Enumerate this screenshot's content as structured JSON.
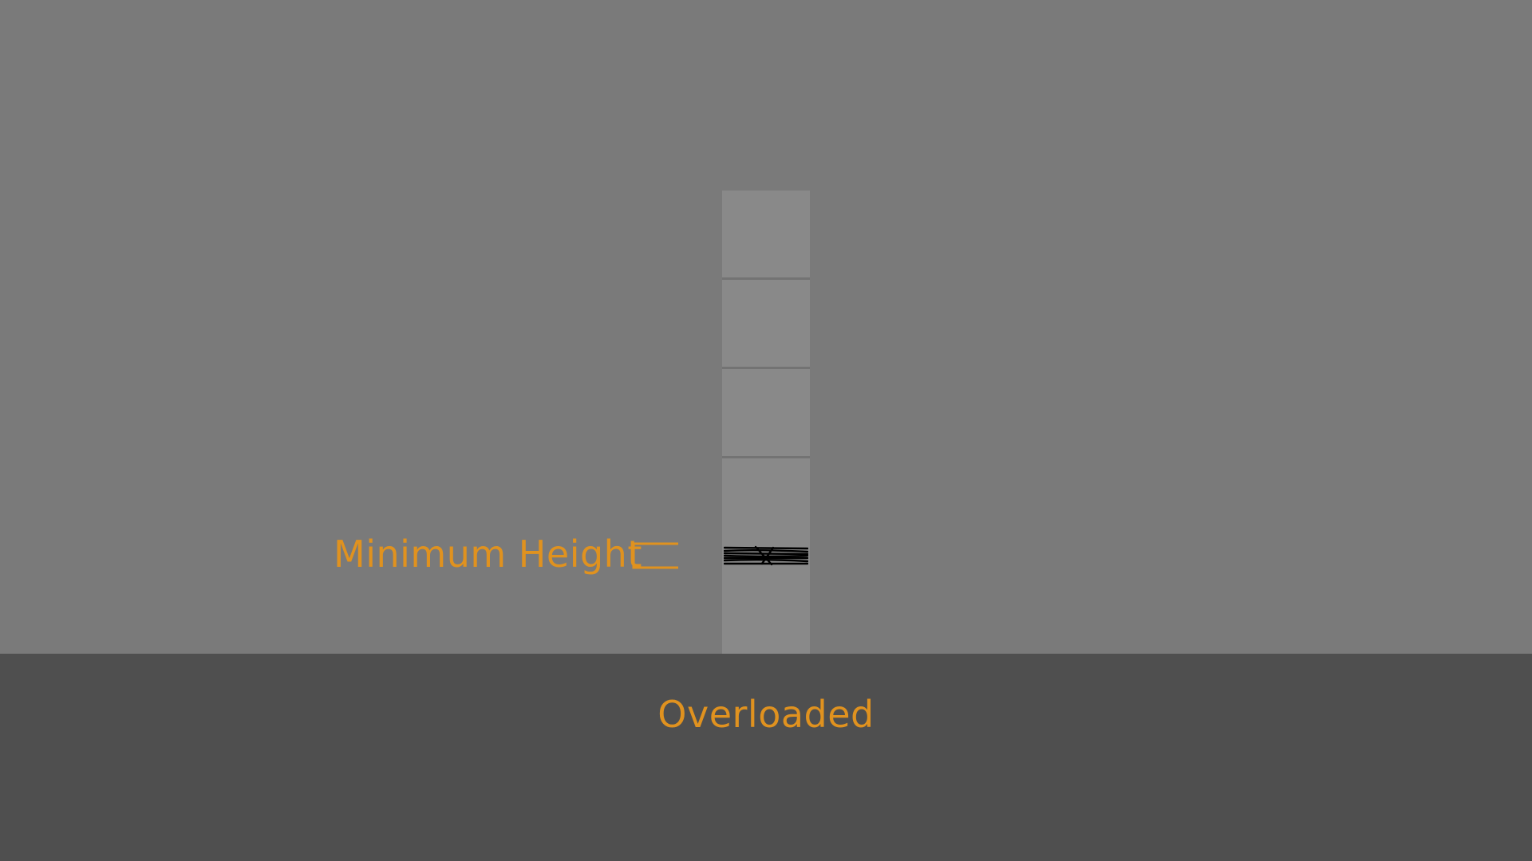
{
  "scene": {
    "background_color": "#7a7a7a",
    "column_color": "#898989",
    "divider_color": "#737373",
    "floor_color": "#4f4f4f",
    "accent_color": "#e0921f",
    "squash_color": "#000000"
  },
  "annotation": {
    "label": "Minimum Height",
    "marker_icon": "bracket-marker-icon"
  },
  "footer": {
    "status_text": "Overloaded"
  }
}
